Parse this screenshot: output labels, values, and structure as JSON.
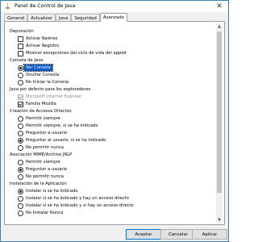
{
  "window": {
    "title": "Panel de Control de Java",
    "close_icon": "✕"
  },
  "tabs": [
    {
      "label": "General",
      "active": false
    },
    {
      "label": "Actualizar",
      "active": false
    },
    {
      "label": "Java",
      "active": false
    },
    {
      "label": "Seguridad",
      "active": false
    },
    {
      "label": "Avanzado",
      "active": true
    }
  ],
  "settings": {
    "depuracion": {
      "header": "Depuración",
      "items": [
        {
          "label": "Activar Rastreo",
          "checked": false
        },
        {
          "label": "Activar Registro",
          "checked": false
        },
        {
          "label": "Mostrar excepciones del ciclo de vida del applet",
          "checked": false
        }
      ]
    },
    "consola": {
      "header": "Consola de Java",
      "items": [
        {
          "label": "Ver Consola",
          "selected": true
        },
        {
          "label": "Ocultar Consola",
          "selected": false
        },
        {
          "label": "No Iniciar la Consola",
          "selected": false
        }
      ]
    },
    "exploradores": {
      "header": "Java por defecto para los exploradores",
      "items": [
        {
          "label": "Microsoft Internet Explorer",
          "checked": true,
          "disabled": true
        },
        {
          "label": "Familia Mozilla",
          "checked": true,
          "disabled": false
        }
      ]
    },
    "accesos": {
      "header": "Creación de Accesos Directos",
      "items": [
        {
          "label": "Permitir siempre",
          "selected": false
        },
        {
          "label": "Permitir siempre, si se ha indicado",
          "selected": false
        },
        {
          "label": "Preguntar a usuario",
          "selected": false
        },
        {
          "label": "Preguntar al usuario, si se ha indicado",
          "selected": true
        },
        {
          "label": "No permitir nunca",
          "selected": false
        }
      ]
    },
    "jnlp": {
      "header": "Asociación MIME/Archivo JNLP",
      "items": [
        {
          "label": "Permitir siempre",
          "selected": false
        },
        {
          "label": "Preguntar a usuario",
          "selected": true
        },
        {
          "label": "No permitir nunca",
          "selected": false
        }
      ]
    },
    "instalacion": {
      "header": "Instalación de la Aplicación",
      "items": [
        {
          "label": "Instalar si se ha indicado",
          "selected": true
        },
        {
          "label": "Instalar si se ha indicado y hay un acceso directo",
          "selected": false
        },
        {
          "label": "Instalar si se ha indicado y si hay un acceso directo",
          "selected": false
        },
        {
          "label": "No Instalar Nunca",
          "selected": false
        }
      ]
    }
  },
  "footer": {
    "ok_label": "Aceptar",
    "cancel_label": "Cancelar",
    "apply_label": "Aplicar"
  }
}
